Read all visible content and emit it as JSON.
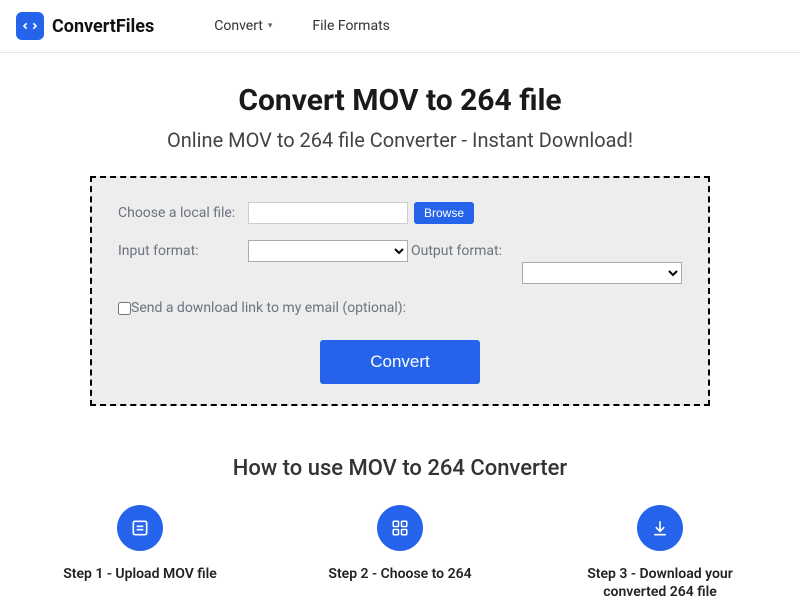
{
  "header": {
    "brand": "ConvertFiles",
    "nav": {
      "convert": "Convert",
      "formats": "File Formats"
    }
  },
  "main": {
    "title": "Convert MOV to 264 file",
    "subtitle": "Online MOV to 264 file Converter - Instant Download!"
  },
  "form": {
    "choose_label": "Choose a local file:",
    "browse": "Browse",
    "input_format_label": "Input format:",
    "output_format_label": "Output format:",
    "email_label": "Send a download link to my email (optional):",
    "convert_btn": "Convert"
  },
  "howto": {
    "title": "How to use MOV to 264 Converter",
    "steps": [
      "Step 1 - Upload MOV file",
      "Step 2 - Choose to 264",
      "Step 3 - Download your converted 264 file"
    ]
  }
}
